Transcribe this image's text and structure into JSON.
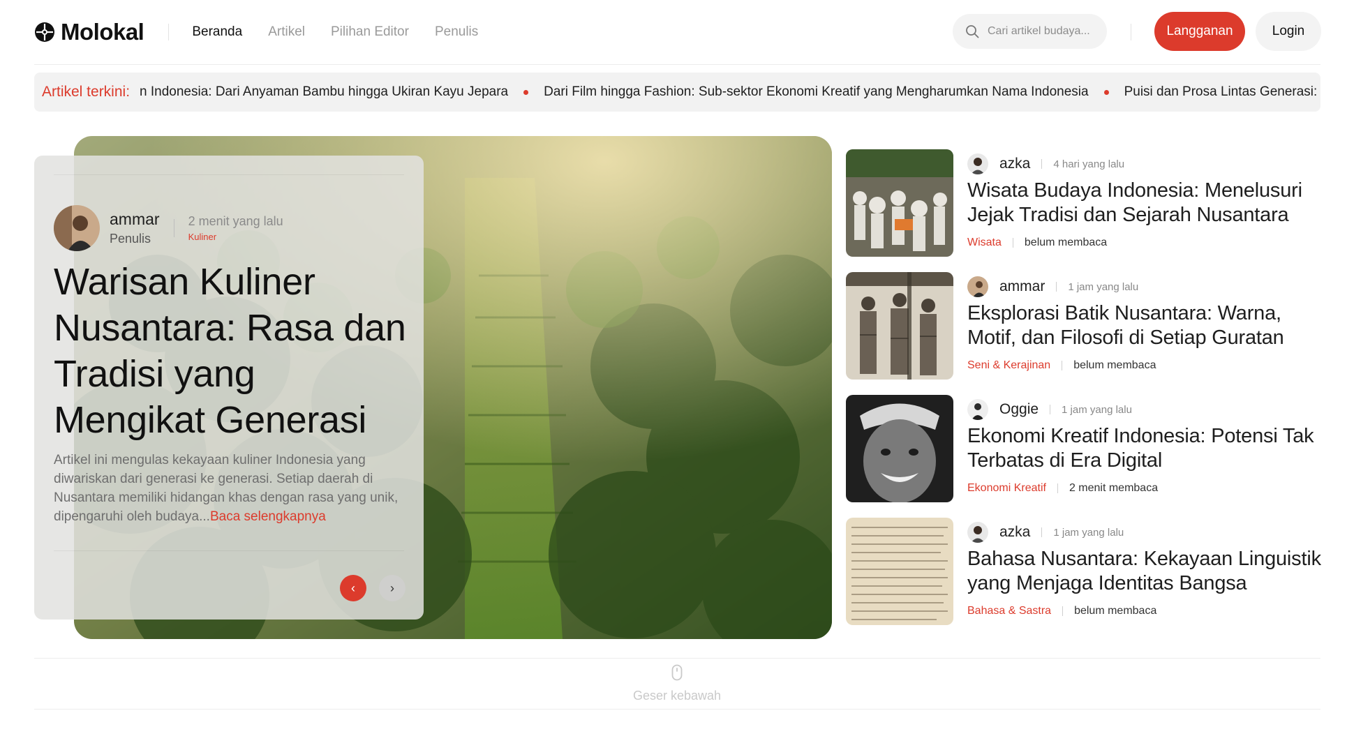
{
  "brand": {
    "name": "Molokal"
  },
  "nav": [
    {
      "label": "Beranda",
      "active": true
    },
    {
      "label": "Artikel",
      "active": false
    },
    {
      "label": "Pilihan Editor",
      "active": false
    },
    {
      "label": "Penulis",
      "active": false
    }
  ],
  "search": {
    "placeholder": "Cari artikel budaya..."
  },
  "actions": {
    "subscribe": "Langganan",
    "login": "Login"
  },
  "ticker": {
    "label": "Artikel terkini:",
    "items": [
      "n Indonesia: Dari Anyaman Bambu hingga Ukiran Kayu Jepara",
      "Dari Film hingga Fashion: Sub-sektor Ekonomi Kreatif yang Mengharumkan Nama Indonesia",
      "Puisi dan Prosa Lintas Generasi:"
    ]
  },
  "hero": {
    "author": "ammar",
    "role": "Penulis",
    "time": "2 menit yang lalu",
    "category": "Kuliner",
    "title": "Warisan Kuliner Nusantara: Rasa dan Tradisi yang Mengikat Generasi",
    "description": "Artikel ini mengulas kekayaan kuliner Indonesia yang diwariskan dari generasi ke generasi. Setiap daerah di Nusantara memiliki hidangan khas dengan rasa yang unik, dipengaruhi oleh budaya...",
    "read_more": "Baca selengkapnya",
    "prev": "‹",
    "next": "›"
  },
  "articles": [
    {
      "author": "azka",
      "time": "4 hari yang lalu",
      "title": "Wisata Budaya Indonesia: Menelusuri Jejak Tradisi dan Sejarah Nusantara",
      "category": "Wisata",
      "read_status": "belum membaca"
    },
    {
      "author": "ammar",
      "time": "1 jam yang lalu",
      "title": "Eksplorasi Batik Nusantara: Warna, Motif, dan Filosofi di Setiap Guratan",
      "category": "Seni & Kerajinan",
      "read_status": "belum membaca"
    },
    {
      "author": "Oggie",
      "time": "1 jam yang lalu",
      "title": "Ekonomi Kreatif Indonesia: Potensi Tak Terbatas di Era Digital",
      "category": "Ekonomi Kreatif",
      "read_status": "2 menit membaca"
    },
    {
      "author": "azka",
      "time": "1 jam yang lalu",
      "title": "Bahasa Nusantara: Kekayaan Linguistik yang Menjaga Identitas Bangsa",
      "category": "Bahasa & Sastra",
      "read_status": "belum membaca"
    }
  ],
  "scroll_hint": "Geser kebawah",
  "colors": {
    "accent": "#dc3b2c",
    "text": "#1e1e1e",
    "muted": "#8a8a8a"
  },
  "icons": [
    "logo-icon",
    "search-icon",
    "chevron-left-icon",
    "chevron-right-icon",
    "mouse-icon"
  ]
}
